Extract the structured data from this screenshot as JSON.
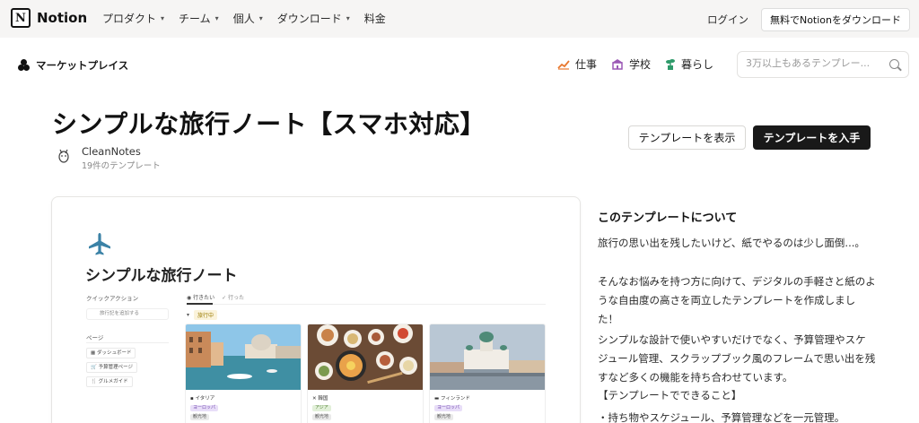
{
  "topnav": {
    "brand": "Notion",
    "brand_letter": "N",
    "items": [
      "プロダクト",
      "チーム",
      "個人",
      "ダウンロード",
      "料金"
    ],
    "login": "ログイン",
    "download_button": "無料でNotionをダウンロード"
  },
  "marketplace": {
    "label": "マーケットプレイス",
    "categories": [
      {
        "label": "仕事",
        "icon": "chart-icon"
      },
      {
        "label": "学校",
        "icon": "school-icon"
      },
      {
        "label": "暮らし",
        "icon": "plant-icon"
      }
    ],
    "search_placeholder": "3万以上もあるテンプレー..."
  },
  "template": {
    "title": "シンプルな旅行ノート【スマホ対応】",
    "author": "CleanNotes",
    "author_count": "19件のテンプレート",
    "view_button": "テンプレートを表示",
    "get_button": "テンプレートを入手"
  },
  "preview": {
    "page_title": "シンプルな旅行ノート",
    "quick_action_label": "クイックアクション",
    "quick_action_button": "旅行記を追加する",
    "pages_label": "ページ",
    "pages": [
      "ダッシュボード",
      "予算管理ページ",
      "グルメガイド"
    ],
    "tabs": [
      "行きたい",
      "行った"
    ],
    "filter": "旅行中",
    "cards": [
      {
        "name": "イタリア",
        "tags": [
          "ヨーロッパ",
          "観光地"
        ]
      },
      {
        "name": "韓国",
        "tags": [
          "アジア",
          "観光地"
        ]
      },
      {
        "name": "フィンランド",
        "tags": [
          "ヨーロッパ",
          "観光地"
        ]
      }
    ]
  },
  "about": {
    "heading": "このテンプレートについて",
    "p1": "旅行の思い出を残したいけど、紙でやるのは少し面倒...。",
    "p2": "そんなお悩みを持つ方に向けて、デジタルの手軽さと紙のような自由度の高さを両立したテンプレートを作成しました！",
    "p3": "シンプルな設計で使いやすいだけでなく、予算管理やスケジュール管理、スクラップブック風のフレームで思い出を残すなど多くの機能を持ち合わせています。",
    "p4": "【テンプレートでできること】",
    "p5": "・持ち物やスケジュール、予算管理などを一元管理。"
  },
  "colors": {
    "nav_bg": "#f6f5f4",
    "primary_button": "#191919",
    "plane_icon": "#3b82a6"
  }
}
